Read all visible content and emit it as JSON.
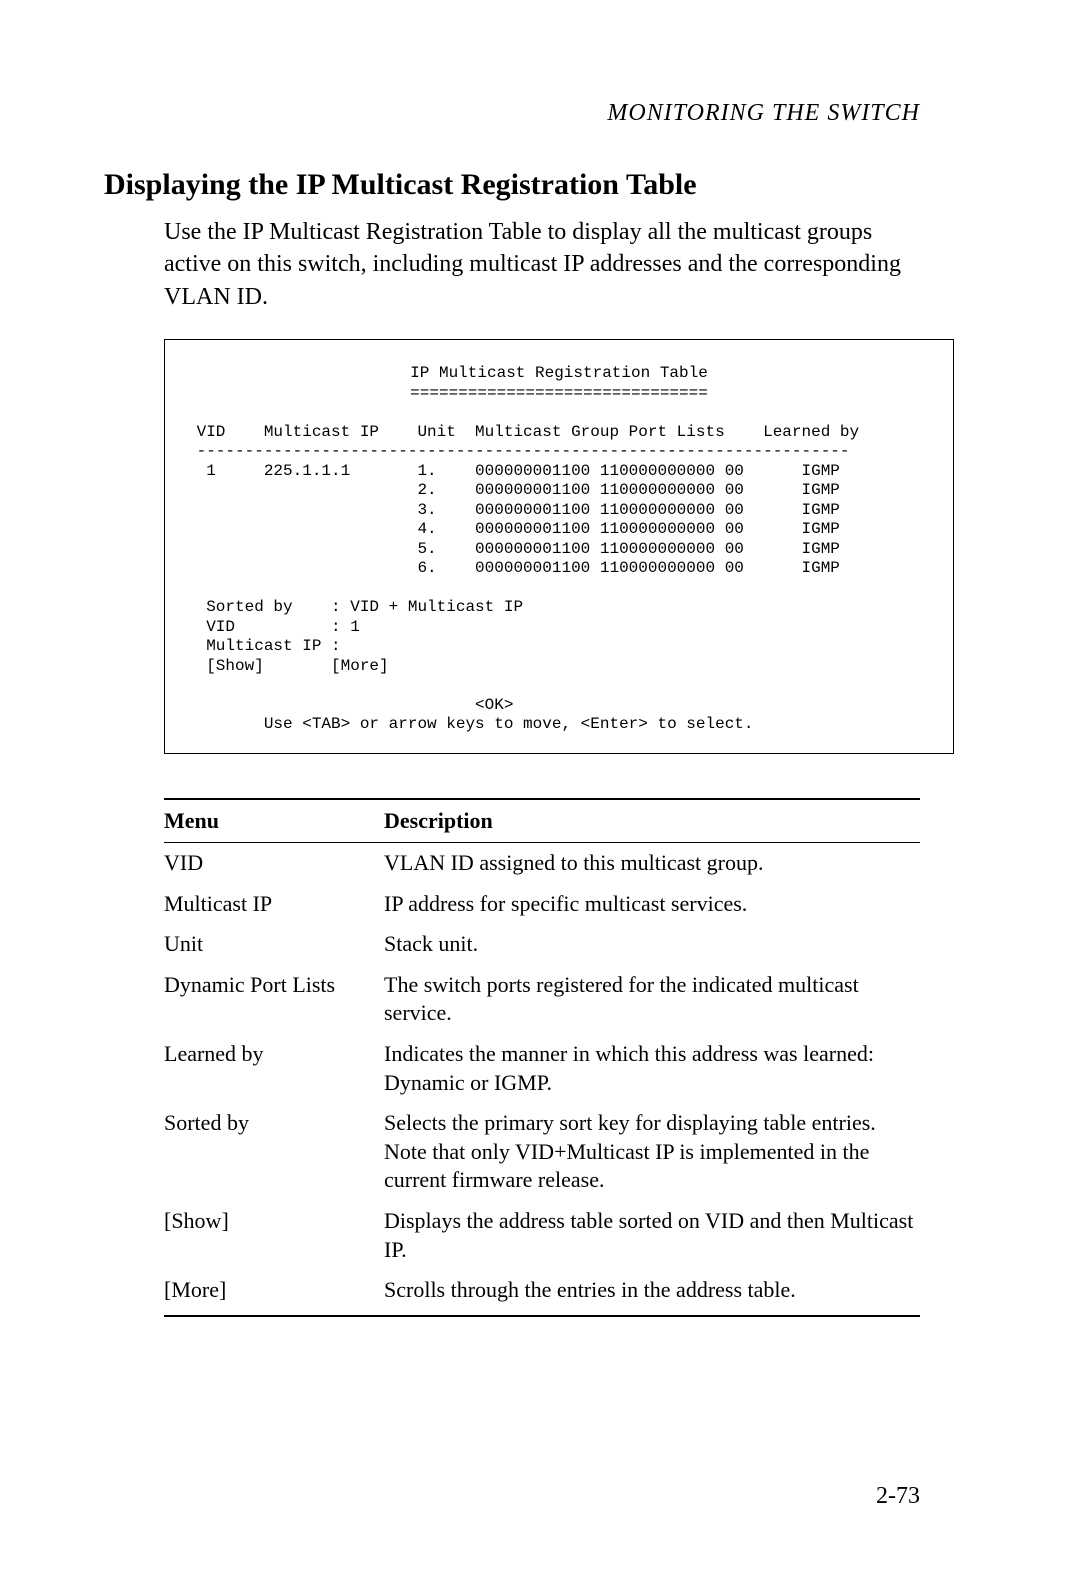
{
  "running_head": "MONITORING THE SWITCH",
  "section_heading": "Displaying the IP Multicast Registration Table",
  "intro_paragraph": "Use the IP Multicast Registration Table to display all the multicast groups active on this switch, including multicast IP addresses and the corresponding VLAN ID.",
  "terminal": {
    "title": "IP Multicast Registration Table",
    "underline": "===============================",
    "columns_line": " VID    Multicast IP    Unit  Multicast Group Port Lists    Learned by",
    "divider": " --------------------------------------------------------------------",
    "rows": [
      "  1     225.1.1.1       1.    000000001100 110000000000 00      IGMP",
      "                        2.    000000001100 110000000000 00      IGMP",
      "                        3.    000000001100 110000000000 00      IGMP",
      "                        4.    000000001100 110000000000 00      IGMP",
      "                        5.    000000001100 110000000000 00      IGMP",
      "                        6.    000000001100 110000000000 00      IGMP"
    ],
    "sorted_by": "  Sorted by    : VID + Multicast IP",
    "vid_line": "  VID          : 1",
    "mip_line": "  Multicast IP :",
    "buttons_line": "  [Show]       [More]",
    "ok_line": "                              <OK>",
    "help_line": "        Use <TAB> or arrow keys to move, <Enter> to select."
  },
  "table": {
    "headers": {
      "menu": "Menu",
      "description": "Description"
    },
    "rows": [
      {
        "menu": "VID",
        "description": "VLAN ID assigned to this multicast group."
      },
      {
        "menu": "Multicast IP",
        "description": "IP address for specific multicast services."
      },
      {
        "menu": "Unit",
        "description": "Stack unit."
      },
      {
        "menu": "Dynamic Port Lists",
        "description": "The switch ports registered for the indicated multicast service."
      },
      {
        "menu": "Learned by",
        "description": "Indicates the manner in which this address was learned: Dynamic or IGMP."
      },
      {
        "menu": "Sorted by",
        "description": "Selects the primary sort key for displaying table entries. Note that only VID+Multicast IP is implemented in the current firmware release."
      },
      {
        "menu": "[Show]",
        "description": "Displays the address table sorted on VID and then Multicast IP."
      },
      {
        "menu": "[More]",
        "description": "Scrolls through the entries in the address table."
      }
    ]
  },
  "page_number": "2-73"
}
